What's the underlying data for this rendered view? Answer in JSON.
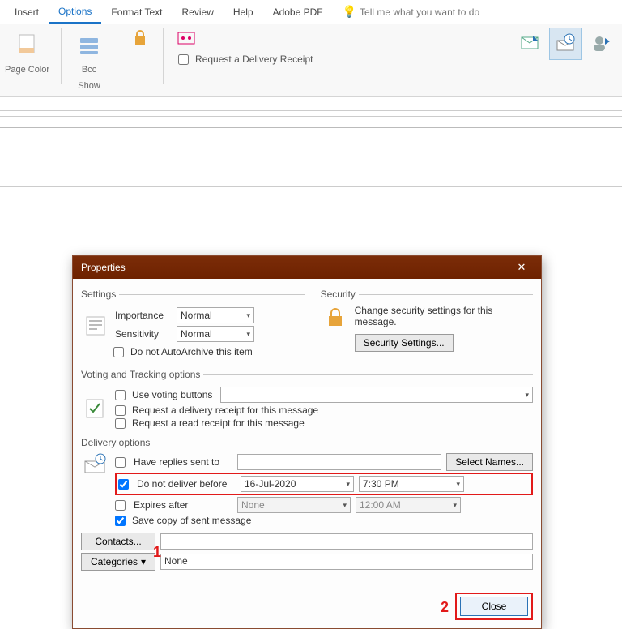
{
  "ribbon": {
    "tabs": [
      "Insert",
      "Options",
      "Format Text",
      "Review",
      "Help",
      "Adobe PDF"
    ],
    "active_tab_index": 1,
    "tell_me": "Tell me what you want to do",
    "page_color": "Page Color",
    "bcc": "Bcc",
    "show": "Show",
    "delivery_receipt": "Request a Delivery Receipt"
  },
  "dialog": {
    "title": "Properties",
    "settings": {
      "legend": "Settings",
      "importance_label": "Importance",
      "importance_value": "Normal",
      "sensitivity_label": "Sensitivity",
      "sensitivity_value": "Normal",
      "autoarchive_label": "Do not AutoArchive this item"
    },
    "security": {
      "legend": "Security",
      "desc": "Change security settings for this message.",
      "button": "Security Settings..."
    },
    "voting": {
      "legend": "Voting and Tracking options",
      "use_voting": "Use voting buttons",
      "req_delivery": "Request a delivery receipt for this message",
      "req_read": "Request a read receipt for this message"
    },
    "delivery": {
      "legend": "Delivery options",
      "have_replies": "Have replies sent to",
      "select_names": "Select Names...",
      "do_not_deliver": "Do not deliver before",
      "date_value": "16-Jul-2020",
      "time_value": "7:30 PM",
      "expires_after": "Expires after",
      "expires_date": "None",
      "expires_time": "12:00 AM",
      "save_copy": "Save copy of sent message",
      "contacts": "Contacts...",
      "categories": "Categories",
      "categories_value": "None"
    },
    "close": "Close",
    "annot1": "1",
    "annot2": "2"
  }
}
